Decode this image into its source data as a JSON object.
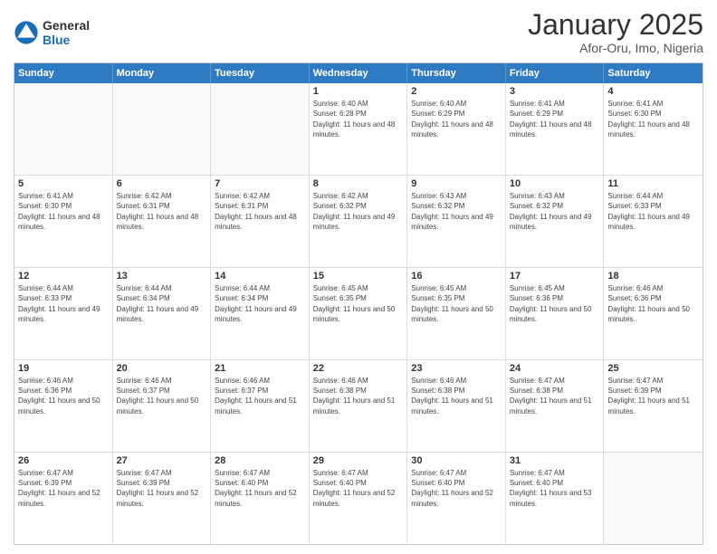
{
  "logo": {
    "text_general": "General",
    "text_blue": "Blue"
  },
  "header": {
    "title": "January 2025",
    "subtitle": "Afor-Oru, Imo, Nigeria"
  },
  "days_of_week": [
    "Sunday",
    "Monday",
    "Tuesday",
    "Wednesday",
    "Thursday",
    "Friday",
    "Saturday"
  ],
  "weeks": [
    [
      {
        "day": "",
        "empty": true
      },
      {
        "day": "",
        "empty": true
      },
      {
        "day": "",
        "empty": true
      },
      {
        "day": "1",
        "sunrise": "6:40 AM",
        "sunset": "6:28 PM",
        "daylight": "11 hours and 48 minutes."
      },
      {
        "day": "2",
        "sunrise": "6:40 AM",
        "sunset": "6:29 PM",
        "daylight": "11 hours and 48 minutes."
      },
      {
        "day": "3",
        "sunrise": "6:41 AM",
        "sunset": "6:29 PM",
        "daylight": "11 hours and 48 minutes."
      },
      {
        "day": "4",
        "sunrise": "6:41 AM",
        "sunset": "6:30 PM",
        "daylight": "11 hours and 48 minutes."
      }
    ],
    [
      {
        "day": "5",
        "sunrise": "6:41 AM",
        "sunset": "6:30 PM",
        "daylight": "11 hours and 48 minutes."
      },
      {
        "day": "6",
        "sunrise": "6:42 AM",
        "sunset": "6:31 PM",
        "daylight": "11 hours and 48 minutes."
      },
      {
        "day": "7",
        "sunrise": "6:42 AM",
        "sunset": "6:31 PM",
        "daylight": "11 hours and 48 minutes."
      },
      {
        "day": "8",
        "sunrise": "6:42 AM",
        "sunset": "6:32 PM",
        "daylight": "11 hours and 49 minutes."
      },
      {
        "day": "9",
        "sunrise": "6:43 AM",
        "sunset": "6:32 PM",
        "daylight": "11 hours and 49 minutes."
      },
      {
        "day": "10",
        "sunrise": "6:43 AM",
        "sunset": "6:32 PM",
        "daylight": "11 hours and 49 minutes."
      },
      {
        "day": "11",
        "sunrise": "6:44 AM",
        "sunset": "6:33 PM",
        "daylight": "11 hours and 49 minutes."
      }
    ],
    [
      {
        "day": "12",
        "sunrise": "6:44 AM",
        "sunset": "6:33 PM",
        "daylight": "11 hours and 49 minutes."
      },
      {
        "day": "13",
        "sunrise": "6:44 AM",
        "sunset": "6:34 PM",
        "daylight": "11 hours and 49 minutes."
      },
      {
        "day": "14",
        "sunrise": "6:44 AM",
        "sunset": "6:34 PM",
        "daylight": "11 hours and 49 minutes."
      },
      {
        "day": "15",
        "sunrise": "6:45 AM",
        "sunset": "6:35 PM",
        "daylight": "11 hours and 50 minutes."
      },
      {
        "day": "16",
        "sunrise": "6:45 AM",
        "sunset": "6:35 PM",
        "daylight": "11 hours and 50 minutes."
      },
      {
        "day": "17",
        "sunrise": "6:45 AM",
        "sunset": "6:36 PM",
        "daylight": "11 hours and 50 minutes."
      },
      {
        "day": "18",
        "sunrise": "6:46 AM",
        "sunset": "6:36 PM",
        "daylight": "11 hours and 50 minutes."
      }
    ],
    [
      {
        "day": "19",
        "sunrise": "6:46 AM",
        "sunset": "6:36 PM",
        "daylight": "11 hours and 50 minutes."
      },
      {
        "day": "20",
        "sunrise": "6:46 AM",
        "sunset": "6:37 PM",
        "daylight": "11 hours and 50 minutes."
      },
      {
        "day": "21",
        "sunrise": "6:46 AM",
        "sunset": "6:37 PM",
        "daylight": "11 hours and 51 minutes."
      },
      {
        "day": "22",
        "sunrise": "6:46 AM",
        "sunset": "6:38 PM",
        "daylight": "11 hours and 51 minutes."
      },
      {
        "day": "23",
        "sunrise": "6:46 AM",
        "sunset": "6:38 PM",
        "daylight": "11 hours and 51 minutes."
      },
      {
        "day": "24",
        "sunrise": "6:47 AM",
        "sunset": "6:38 PM",
        "daylight": "11 hours and 51 minutes."
      },
      {
        "day": "25",
        "sunrise": "6:47 AM",
        "sunset": "6:39 PM",
        "daylight": "11 hours and 51 minutes."
      }
    ],
    [
      {
        "day": "26",
        "sunrise": "6:47 AM",
        "sunset": "6:39 PM",
        "daylight": "11 hours and 52 minutes."
      },
      {
        "day": "27",
        "sunrise": "6:47 AM",
        "sunset": "6:39 PM",
        "daylight": "11 hours and 52 minutes."
      },
      {
        "day": "28",
        "sunrise": "6:47 AM",
        "sunset": "6:40 PM",
        "daylight": "11 hours and 52 minutes."
      },
      {
        "day": "29",
        "sunrise": "6:47 AM",
        "sunset": "6:40 PM",
        "daylight": "11 hours and 52 minutes."
      },
      {
        "day": "30",
        "sunrise": "6:47 AM",
        "sunset": "6:40 PM",
        "daylight": "11 hours and 52 minutes."
      },
      {
        "day": "31",
        "sunrise": "6:47 AM",
        "sunset": "6:40 PM",
        "daylight": "11 hours and 53 minutes."
      },
      {
        "day": "",
        "empty": true
      }
    ]
  ],
  "labels": {
    "sunrise": "Sunrise:",
    "sunset": "Sunset:",
    "daylight": "Daylight:"
  }
}
